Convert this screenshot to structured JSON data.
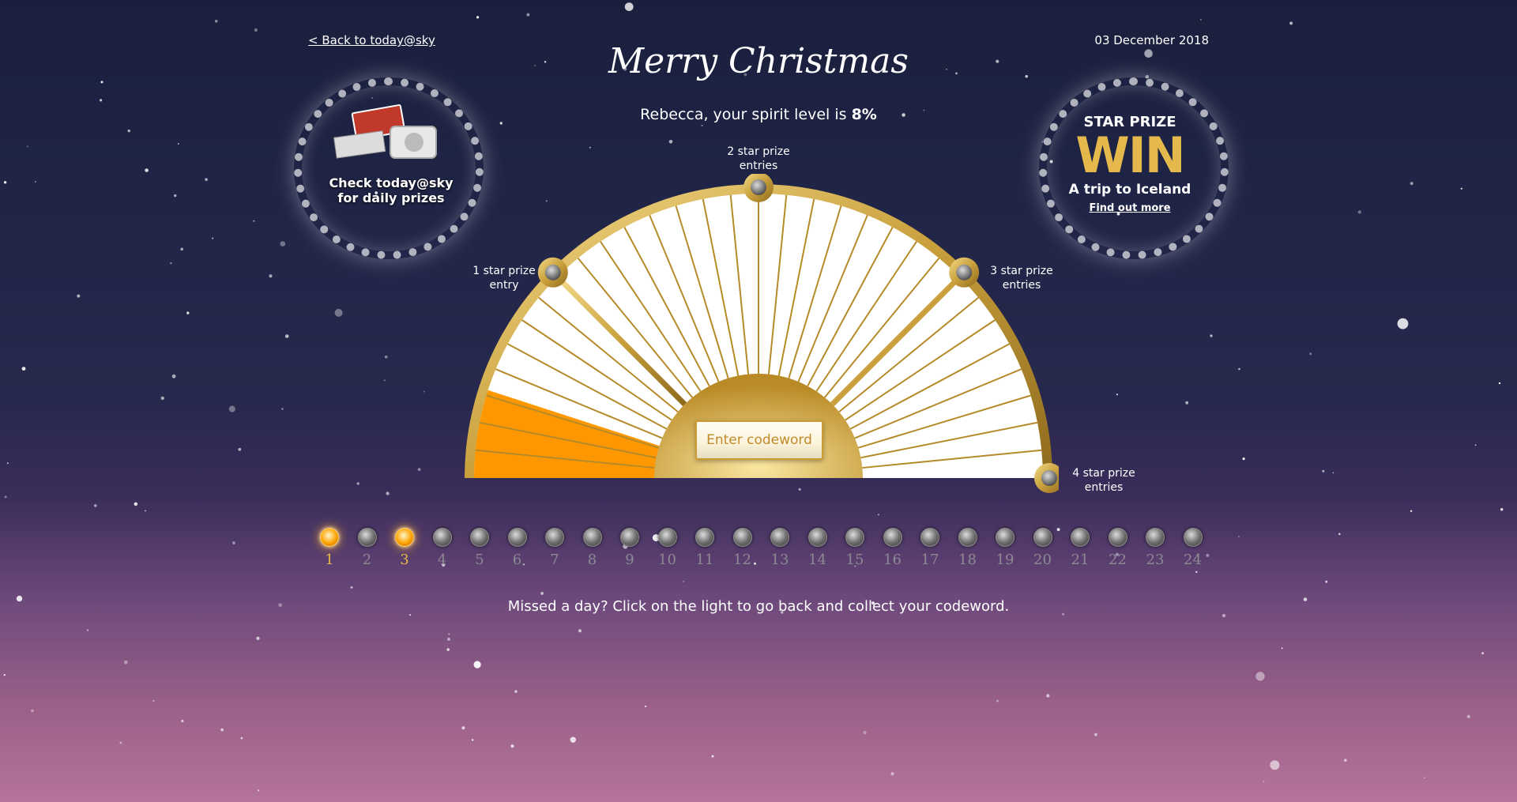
{
  "header": {
    "back_link": "< Back to today@sky",
    "date": "03 December 2018",
    "title": "Merry Christmas",
    "spirit_prefix": "Rebecca, your spirit level is ",
    "spirit_value": "8%"
  },
  "left_promo": {
    "text_line1": "Check today@sky",
    "text_line2": "for daily prizes"
  },
  "right_promo": {
    "star_prize": "STAR PRIZE",
    "win": "WIN",
    "trip": "A trip to Iceland",
    "find_out": "Find out more"
  },
  "dial": {
    "fill_fraction": 0.08,
    "codeword_button": "Enter codeword",
    "levels": [
      {
        "line1": "1 star prize",
        "line2": "entry"
      },
      {
        "line1": "2 star prize",
        "line2": "entries"
      },
      {
        "line1": "3 star prize",
        "line2": "entries"
      },
      {
        "line1": "4 star prize",
        "line2": "entries"
      }
    ],
    "colors": {
      "gold": "#c9a03c",
      "fill": "#ff9800",
      "panel": "#ffffff"
    }
  },
  "days": [
    {
      "n": "1",
      "lit": true
    },
    {
      "n": "2",
      "lit": false
    },
    {
      "n": "3",
      "lit": true
    },
    {
      "n": "4",
      "lit": false
    },
    {
      "n": "5",
      "lit": false
    },
    {
      "n": "6",
      "lit": false
    },
    {
      "n": "7",
      "lit": false
    },
    {
      "n": "8",
      "lit": false
    },
    {
      "n": "9",
      "lit": false
    },
    {
      "n": "10",
      "lit": false
    },
    {
      "n": "11",
      "lit": false
    },
    {
      "n": "12",
      "lit": false
    },
    {
      "n": "13",
      "lit": false
    },
    {
      "n": "14",
      "lit": false
    },
    {
      "n": "15",
      "lit": false
    },
    {
      "n": "16",
      "lit": false
    },
    {
      "n": "17",
      "lit": false
    },
    {
      "n": "18",
      "lit": false
    },
    {
      "n": "19",
      "lit": false
    },
    {
      "n": "20",
      "lit": false
    },
    {
      "n": "21",
      "lit": false
    },
    {
      "n": "22",
      "lit": false
    },
    {
      "n": "23",
      "lit": false
    },
    {
      "n": "24",
      "lit": false
    }
  ],
  "footer": {
    "missed_text": "Missed a day? Click on the light to go back and collect your codeword."
  }
}
